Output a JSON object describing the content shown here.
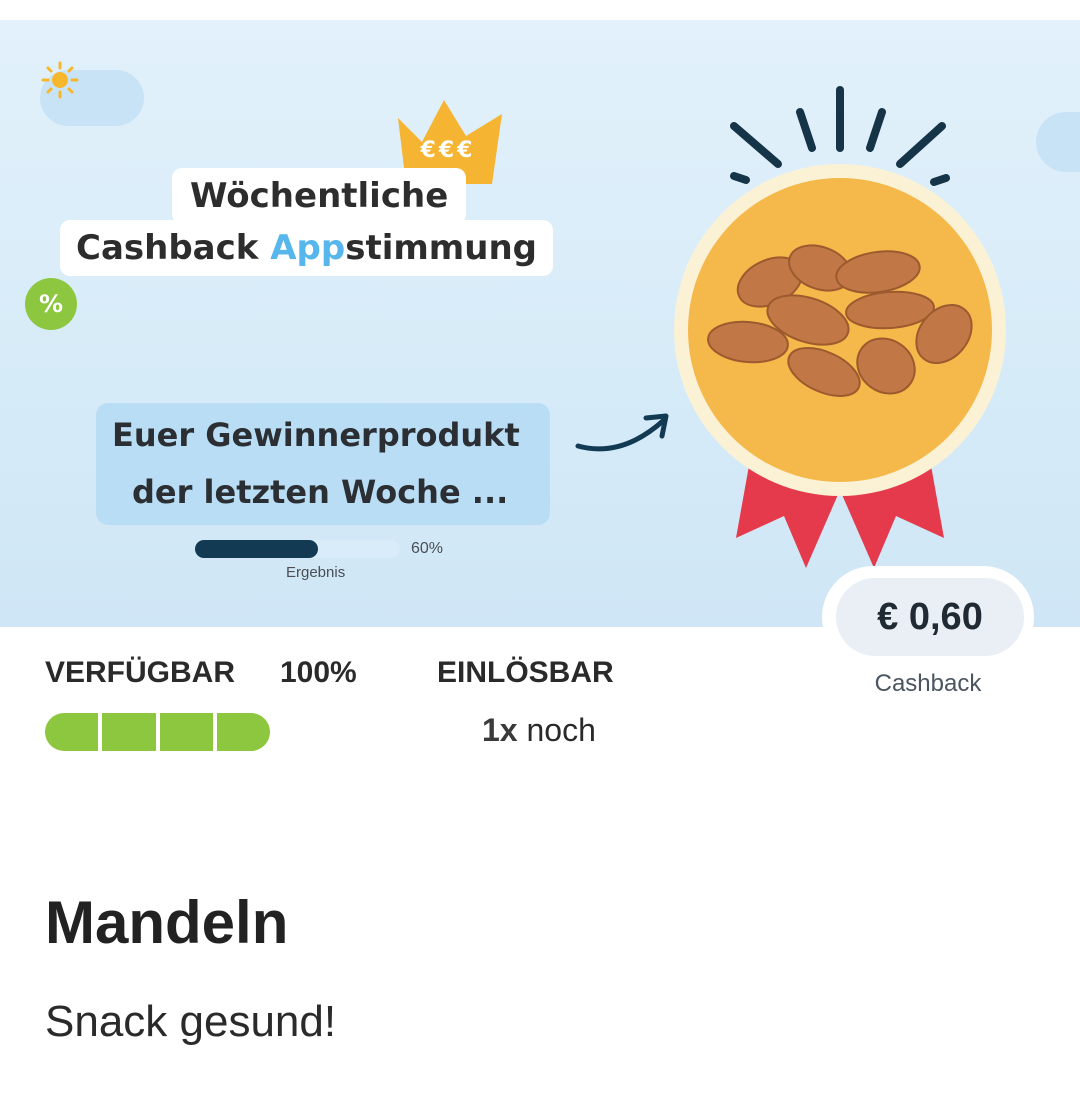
{
  "banner": {
    "crown_text": "€€€",
    "title_line1": "Wöchentliche",
    "title_line2_prefix": "Cashback ",
    "title_line2_accent": "App",
    "title_line2_suffix": "stimmung",
    "percent_badge": "%",
    "winner_line1": "Euer Gewinnerprodukt",
    "winner_line2": "der letzten Woche ...",
    "result_progress": 0.6,
    "result_percent": "60%",
    "result_label": "Ergebnis",
    "colors": {
      "accent": "#57b6ec",
      "badge_green": "#8dc63f",
      "crown": "#f5b431",
      "medal": "#f5b84a",
      "ribbon": "#e53a4b"
    }
  },
  "offer": {
    "cashback_amount": "€ 0,60",
    "cashback_label": "Cashback",
    "available_label": "VERFÜGBAR",
    "available_percent": "100%",
    "available_segments": 4,
    "redeemable_label": "EINLÖSBAR",
    "redeemable_count": "1x",
    "redeemable_suffix": " noch"
  },
  "product": {
    "title": "Mandeln",
    "subtitle": "Snack gesund!"
  }
}
